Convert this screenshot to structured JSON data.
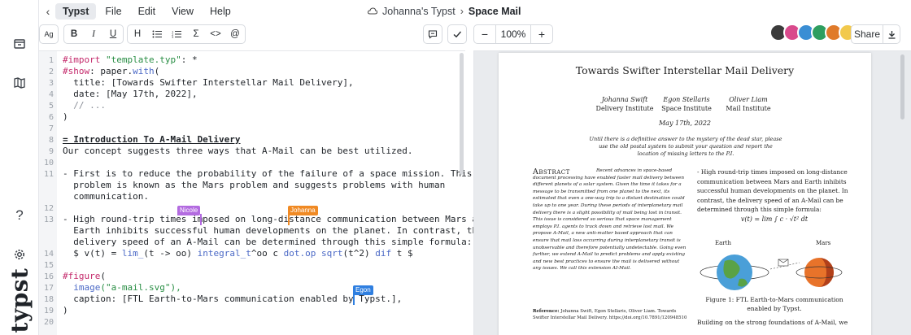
{
  "menubar": {
    "items": [
      "Typst",
      "File",
      "Edit",
      "View",
      "Help"
    ],
    "project": "Johanna's Typst",
    "document": "Space Mail"
  },
  "toolbar": {
    "font_size_label": "Ag",
    "bold": "B",
    "italic": "I",
    "underline": "U",
    "heading": "H",
    "math": "Σ",
    "code": "<>",
    "mention": "@",
    "zoom_minus": "−",
    "zoom_value": "100%",
    "zoom_plus": "+",
    "share_label": "Share",
    "avatars": [
      {
        "color": "#3b3b3b"
      },
      {
        "color": "#d94a8c"
      },
      {
        "color": "#3a8ed4"
      },
      {
        "color": "#2e9e5f"
      },
      {
        "color": "#e07a2a"
      },
      {
        "color": "#f2c94c"
      }
    ]
  },
  "editor": {
    "lines": [
      {
        "n": "1"
      },
      {
        "n": "2"
      },
      {
        "n": "3"
      },
      {
        "n": "4"
      },
      {
        "n": "5"
      },
      {
        "n": "6"
      },
      {
        "n": "7"
      },
      {
        "n": "8"
      },
      {
        "n": "9"
      },
      {
        "n": "10"
      },
      {
        "n": "11"
      },
      {
        "n": "",
        "c": "12"
      },
      {
        "n": "",
        "c": "13"
      },
      {
        "n": "12"
      },
      {
        "n": "13"
      },
      {
        "n": "",
        "c": "15"
      },
      {
        "n": "",
        "c": "16"
      },
      {
        "n": "14"
      },
      {
        "n": "15"
      },
      {
        "n": "16"
      },
      {
        "n": "17"
      },
      {
        "n": "18"
      },
      {
        "n": "19"
      },
      {
        "n": "20"
      }
    ],
    "text": {
      "l1_kw": "#import",
      "l1_str": "\"template.typ\"",
      "l1_rest": ": *",
      "l2_kw": "#show",
      "l2_rest": ": paper.",
      "l2_fn": "with",
      "l2_end": "(",
      "l3": "  title: [Towards Swifter Interstellar Mail Delivery],",
      "l4": "  date: [May 17th, 2022],",
      "l5": "  // ...",
      "l6": ")",
      "l8": "= Introduction To A-Mail Delivery",
      "l9": "Our concept suggests three ways that A-Mail can be best utilized.",
      "l11a": "- First is to reduce the probability of the failure of a space mission. This",
      "l11b": "  problem is known as the Mars problem and suggests problems with human",
      "l11c": "  communication.",
      "l13a": "- High round-trip times imposed on long-distance communication between Mars and",
      "l13b": "  Earth inhibits successful human developments on the planet. In contrast, the",
      "l13c": "  delivery speed of an A-Mail can be determined through this simple formula:",
      "l14_a": "  $ v(t) = ",
      "l14_b": "lim_",
      "l14_c": "(t -> oo) ",
      "l14_d": "integral_t",
      "l14_e": "^oo c ",
      "l14_f": "dot.op",
      "l14_g": " ",
      "l14_h": "sqrt",
      "l14_i": "(t^2) ",
      "l14_j": "dif",
      "l14_k": " t $",
      "l16_kw": "#figure",
      "l16_rest": "(",
      "l17_fn": "  image",
      "l17_str": "(\"a-mail.svg\"),",
      "l18": "  caption: [FTL Earth-to-Mars communication enabled by Typst.],",
      "l19": ")"
    },
    "cursors": [
      {
        "name": "Nicole",
        "color": "#b36be0"
      },
      {
        "name": "Johanna",
        "color": "#f08a24"
      },
      {
        "name": "Egon",
        "color": "#2f7fe0"
      }
    ]
  },
  "preview": {
    "title": "Towards Swifter Interstellar Mail Delivery",
    "authors": [
      {
        "name": "Johanna Swift",
        "affiliation": "Delivery Institute"
      },
      {
        "name": "Egon Stellaris",
        "affiliation": "Space Institute"
      },
      {
        "name": "Oliver Liam",
        "affiliation": "Mail Institute"
      }
    ],
    "date": "May 17th, 2022",
    "dedication": "Until there is a definitive answer to the mystery of the dead star, please use the old postal system to submit your question and report the location of missing letters to the P.I.",
    "abstract_heading": "Abstract",
    "abstract": "Recent advances in space-based document processing have enabled faster mail delivery between different planets of a solar system. Given the time it takes for a message to be transmitted from one planet to the next, its estimated that even a one-way trip to a distant destination could take up to one year. During these periods of interplanetary mail delivery there is a slight possibility of mail being lost in transit. This issue is considered so serious that space management employs P.I. agents to track down and retrieve lost mail. We propose A-Mail, a new anti-matter based approach that can ensure that mail loss occurring during interplanetary transit is unobservable and therefore potentially undetectable. Going even further, we extend A-Mail to predict problems and apply existing and new best practices to ensure the mail is delivered without any issues. We call this extension AI-Mail.",
    "reference_label": "Reference:",
    "reference": "Johanna Swift, Egon Stellaris, Oliver Liam. Towards Swifter Interstellar Mail Delivery. https://doi.org/10.7891/120948510",
    "col2_text": "- High round-trip times imposed on long-distance communication between Mars and Earth inhibits successful human developments on the planet. In contrast, the delivery speed of an A-Mail can be determined through this simple formula:",
    "formula": "v(t) = lim ∫ c · √t² dt",
    "earth_label": "Earth",
    "mars_label": "Mars",
    "caption": "Figure 1: FTL Earth-to-Mars communication enabled by Typst.",
    "building": "Building on the strong foundations of A-Mail, we"
  }
}
